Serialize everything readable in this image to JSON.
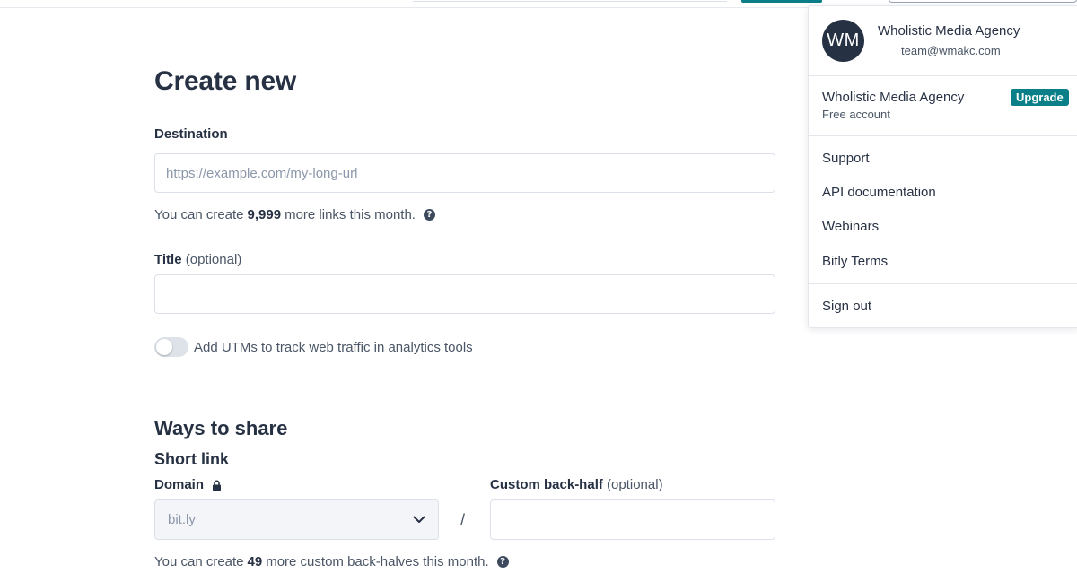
{
  "page": {
    "title": "Create new"
  },
  "destination": {
    "label": "Destination",
    "placeholder": "https://example.com/my-long-url",
    "hint_prefix": "You can create",
    "hint_count": "9,999",
    "hint_suffix": "more links this month."
  },
  "title_field": {
    "label": "Title",
    "optional": "(optional)",
    "value": ""
  },
  "utm": {
    "label": "Add UTMs to track web traffic in analytics tools",
    "enabled": false
  },
  "share": {
    "heading": "Ways to share",
    "short_link_heading": "Short link",
    "domain_label": "Domain",
    "domain_value": "bit.ly",
    "separator": "/",
    "back_half_label": "Custom back-half",
    "back_half_optional": "(optional)",
    "back_half_value": "",
    "hint_prefix": "You can create",
    "hint_count": "49",
    "hint_suffix": "more custom back-halves this month."
  },
  "account_menu": {
    "avatar_initials": "WM",
    "name": "Wholistic Media Agency",
    "email": "team@wmakc.com",
    "account_name": "Wholistic Media Agency",
    "plan": "Free account",
    "upgrade_label": "Upgrade",
    "items": [
      {
        "label": "Support"
      },
      {
        "label": "API documentation"
      },
      {
        "label": "Webinars"
      },
      {
        "label": "Bitly Terms"
      }
    ],
    "sign_out": "Sign out"
  },
  "icons": {
    "help": "help-circle-icon",
    "lock": "lock-icon",
    "chevron": "chevron-down-icon"
  },
  "colors": {
    "accent": "#0a7f88",
    "text": "#273144",
    "avatar_bg": "#273144"
  }
}
